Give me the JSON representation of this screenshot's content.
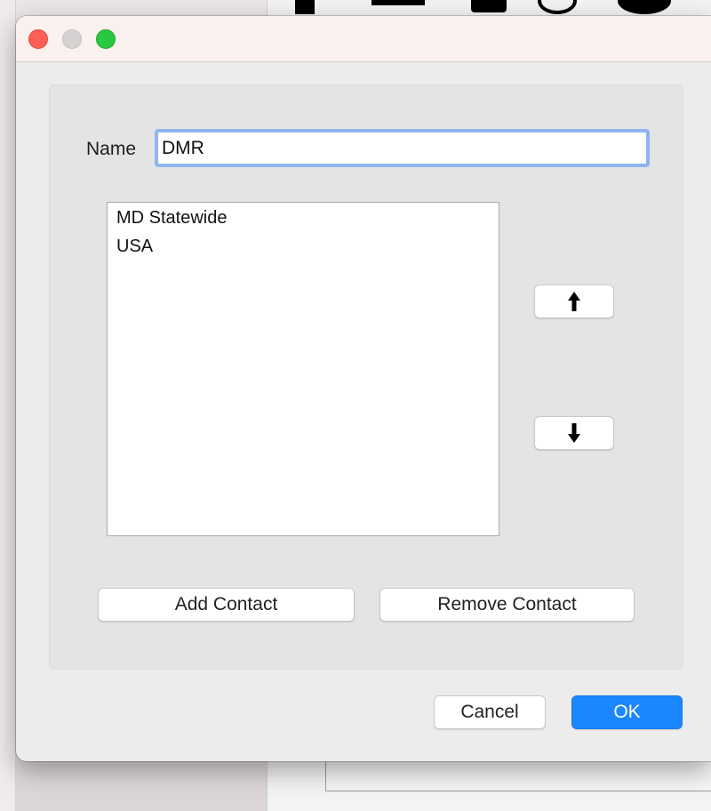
{
  "dialog": {
    "name_label": "Name",
    "name_value": "DMR",
    "contacts": [
      "MD Statewide",
      "USA"
    ],
    "move_up_icon": "arrow-up-icon",
    "move_down_icon": "arrow-down-icon",
    "add_contact_label": "Add Contact",
    "remove_contact_label": "Remove Contact",
    "cancel_label": "Cancel",
    "ok_label": "OK"
  },
  "colors": {
    "accent": "#1a86ff",
    "focus_ring": "#8fb5ee",
    "close": "#ff5f57",
    "minimize_inactive": "#d6d2d2",
    "zoom": "#28c840"
  }
}
